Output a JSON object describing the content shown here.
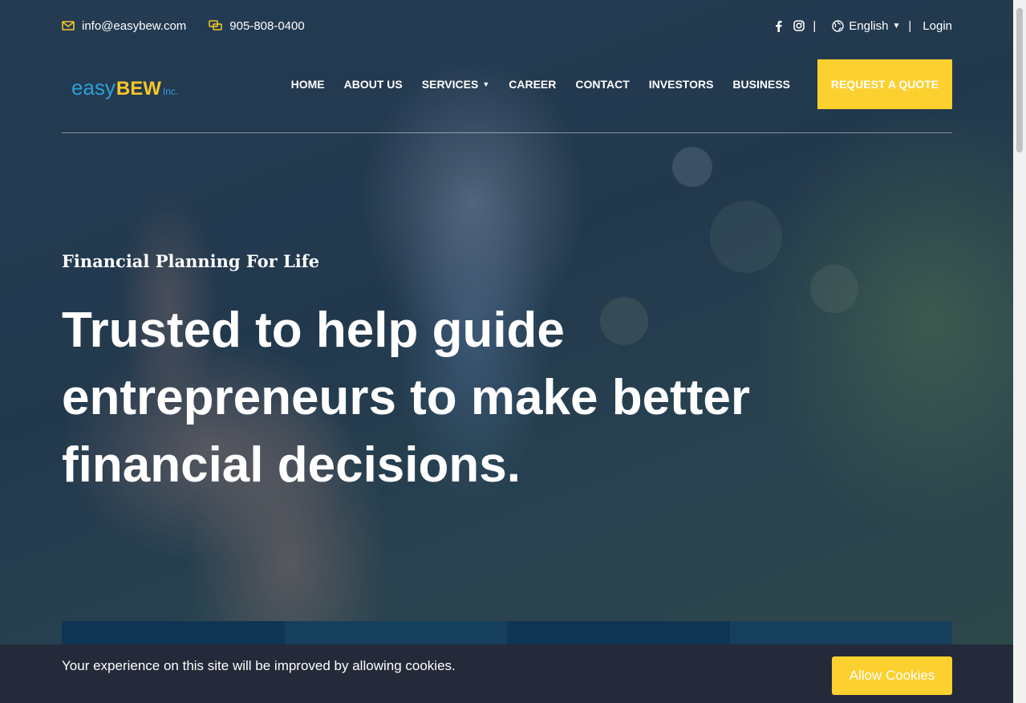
{
  "topbar": {
    "email": "info@easybew.com",
    "phone": "905-808-0400",
    "language": "English",
    "login": "Login",
    "separator": "|",
    "icons": {
      "email": "envelope-icon",
      "phone": "chat-bubble-icon",
      "facebook": "facebook-icon",
      "instagram": "instagram-icon",
      "globe": "globe-icon"
    }
  },
  "logo": {
    "easy": "easy",
    "bew": "BEW",
    "inc": "Inc."
  },
  "nav": {
    "items": [
      {
        "label": "HOME"
      },
      {
        "label": "ABOUT US"
      },
      {
        "label": "SERVICES"
      },
      {
        "label": "CAREER"
      },
      {
        "label": "CONTACT"
      },
      {
        "label": "INVESTORS"
      },
      {
        "label": "BUSINESS"
      }
    ],
    "cta": "REQUEST A QUOTE"
  },
  "hero": {
    "tagline": "Financial Planning For Life",
    "headline": "Trusted to help guide entrepreneurs to make better financial decisions."
  },
  "cookie": {
    "message": "Your experience on this site will be improved by allowing cookies.",
    "button": "Allow Cookies"
  },
  "colors": {
    "accent": "#fcd02f",
    "logo_blue": "#2e9fd5",
    "cookie_bg": "#242a39",
    "card_dark": "#0f3552",
    "card_light": "#153f5c"
  }
}
